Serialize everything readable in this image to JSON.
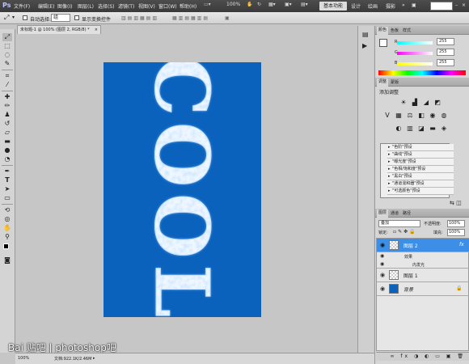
{
  "menubar": {
    "app_logo": "Ps",
    "items": [
      "文件(F)",
      "编辑(E)",
      "图像(I)",
      "图层(L)",
      "选择(S)",
      "滤镜(T)",
      "视图(V)",
      "窗口(W)",
      "帮助(H)"
    ],
    "zoom": "100%",
    "essentials": "基本功能",
    "workspaces": [
      "设计",
      "绘画",
      "摄影"
    ],
    "more": "»"
  },
  "options_bar": {
    "auto_select_label": "自动选择:",
    "auto_select_value": "组",
    "show_transform_label": "显示变换控件"
  },
  "document": {
    "tab_title": "未标题-1 @ 100% (图层 2, RGB/8) *",
    "canvas_color": "#0a62bd",
    "text_art": "COOL"
  },
  "status": {
    "zoom": "100%",
    "doc_info": "文档:922.1K/2.46M",
    "watermark": "Bai 贴吧 | photoshop吧"
  },
  "color_panel": {
    "tabs": [
      "颜色",
      "色板",
      "样式"
    ],
    "channels": [
      {
        "label": "R",
        "value": "255"
      },
      {
        "label": "G",
        "value": "255"
      },
      {
        "label": "B",
        "value": "255"
      }
    ]
  },
  "adjustments_panel": {
    "tabs": [
      "调整",
      "蒙版"
    ],
    "title": "添加调整",
    "presets": [
      "\"色阶\"预设",
      "\"曲线\"预设",
      "\"曝光度\"预设",
      "\"色相/饱和度\"预设",
      "\"黑白\"预设",
      "\"通道混和器\"预设",
      "\"可选颜色\"预设"
    ]
  },
  "layers_panel": {
    "tabs": [
      "图层",
      "通道",
      "路径"
    ],
    "blend_mode": "叠加",
    "opacity_label": "不透明度:",
    "opacity_value": "100%",
    "lock_label": "锁定:",
    "fill_label": "填充:",
    "fill_value": "100%",
    "layers": [
      {
        "name": "图层 2",
        "selected": true,
        "fx": "fx"
      },
      {
        "name": "效果",
        "sub": true
      },
      {
        "name": "内发光",
        "sub": true
      },
      {
        "name": "图层 1",
        "selected": false
      },
      {
        "name": "背景",
        "selected": false,
        "locked": true
      }
    ]
  }
}
